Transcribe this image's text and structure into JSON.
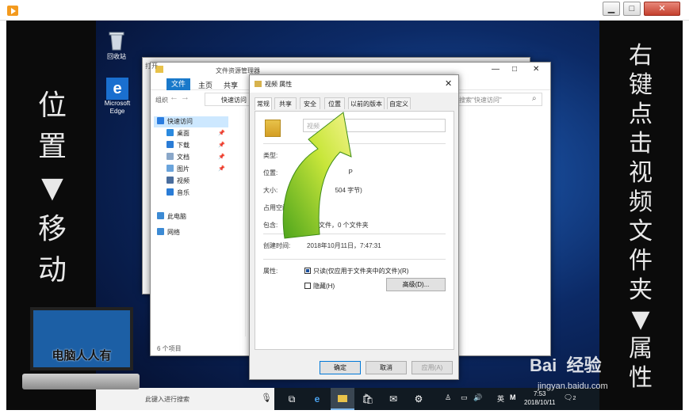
{
  "player": {
    "title_buttons": [
      "▁",
      "□",
      "✕"
    ]
  },
  "left_caption": "位\n置\n▼\n移\n动",
  "right_caption": "右\n键\n点\n击\n视\n频\n文\n件\n夹\n▼\n属\n性",
  "desktop": {
    "icons": [
      {
        "label": "回收站",
        "icon": "recycle-bin-icon"
      },
      {
        "label": "Microsoft Edge",
        "icon": "edge-icon"
      }
    ],
    "partial_label": "打开"
  },
  "explorer": {
    "title": "文件资源管理器",
    "ribbon_tabs": [
      "文件",
      "主页",
      "共享"
    ],
    "ribbon_overflow": "组织",
    "address": "快速访问",
    "search_placeholder": "搜索\"快速访问\"",
    "nav": [
      {
        "label": "快速访问",
        "color": "#2b7de0",
        "pinned": false
      },
      {
        "label": "桌面",
        "color": "#2b8adf",
        "pinned": true
      },
      {
        "label": "下载",
        "color": "#2a7cd6",
        "pinned": true
      },
      {
        "label": "文档",
        "color": "#8aa7c9",
        "pinned": true
      },
      {
        "label": "图片",
        "color": "#6aa4dc",
        "pinned": true
      },
      {
        "label": "视频",
        "color": "#4a6e9e",
        "pinned": false
      },
      {
        "label": "音乐",
        "color": "#2a7cd6",
        "pinned": false
      },
      {
        "label": "此电脑",
        "color": "#3c8ad4",
        "pinned": false
      },
      {
        "label": "网络",
        "color": "#3c8ad4",
        "pinned": false
      }
    ],
    "status": "6 个项目",
    "window_buttons": [
      "—",
      "□",
      "✕"
    ]
  },
  "dialog": {
    "title": "视频 属性",
    "tabs": [
      "常规",
      "共享",
      "安全",
      "位置",
      "以前的版本",
      "自定义"
    ],
    "name_value": "视频",
    "rows": [
      {
        "label": "类型:",
        "value": ""
      },
      {
        "label": "位置:",
        "value": "C:                    P"
      },
      {
        "label": "大小:",
        "value": "                504 字节)"
      },
      {
        "label": "占用空间:",
        "value": ""
      },
      {
        "label": "包含:",
        "value": "个文件，0 个文件夹"
      },
      {
        "label": "创建时间:",
        "value": "2018年10月11日，7:47:31"
      }
    ],
    "attributes_label": "属性:",
    "readonly_label": "只读(仅应用于文件夹中的文件)(R)",
    "hidden_label": "隐藏(H)",
    "advanced_label": "高级(D)...",
    "ok_label": "确定",
    "cancel_label": "取消",
    "apply_label": "应用(A)",
    "close": "✕"
  },
  "taskbar": {
    "search_text": "此键入进行搜索",
    "tray_lang": "英",
    "tray_app": "M",
    "clock_time": "7:53",
    "clock_date": "2018/10/11",
    "notify_count": "2"
  },
  "watermark": {
    "brand": "Bai  经验",
    "url": "jingyan.baidu.com"
  },
  "logo": {
    "text": "电脑人人有"
  },
  "colors": {
    "accent": "#1979ca",
    "arrow": "#7ac41f",
    "dialog_bg": "#f0f0f0"
  }
}
